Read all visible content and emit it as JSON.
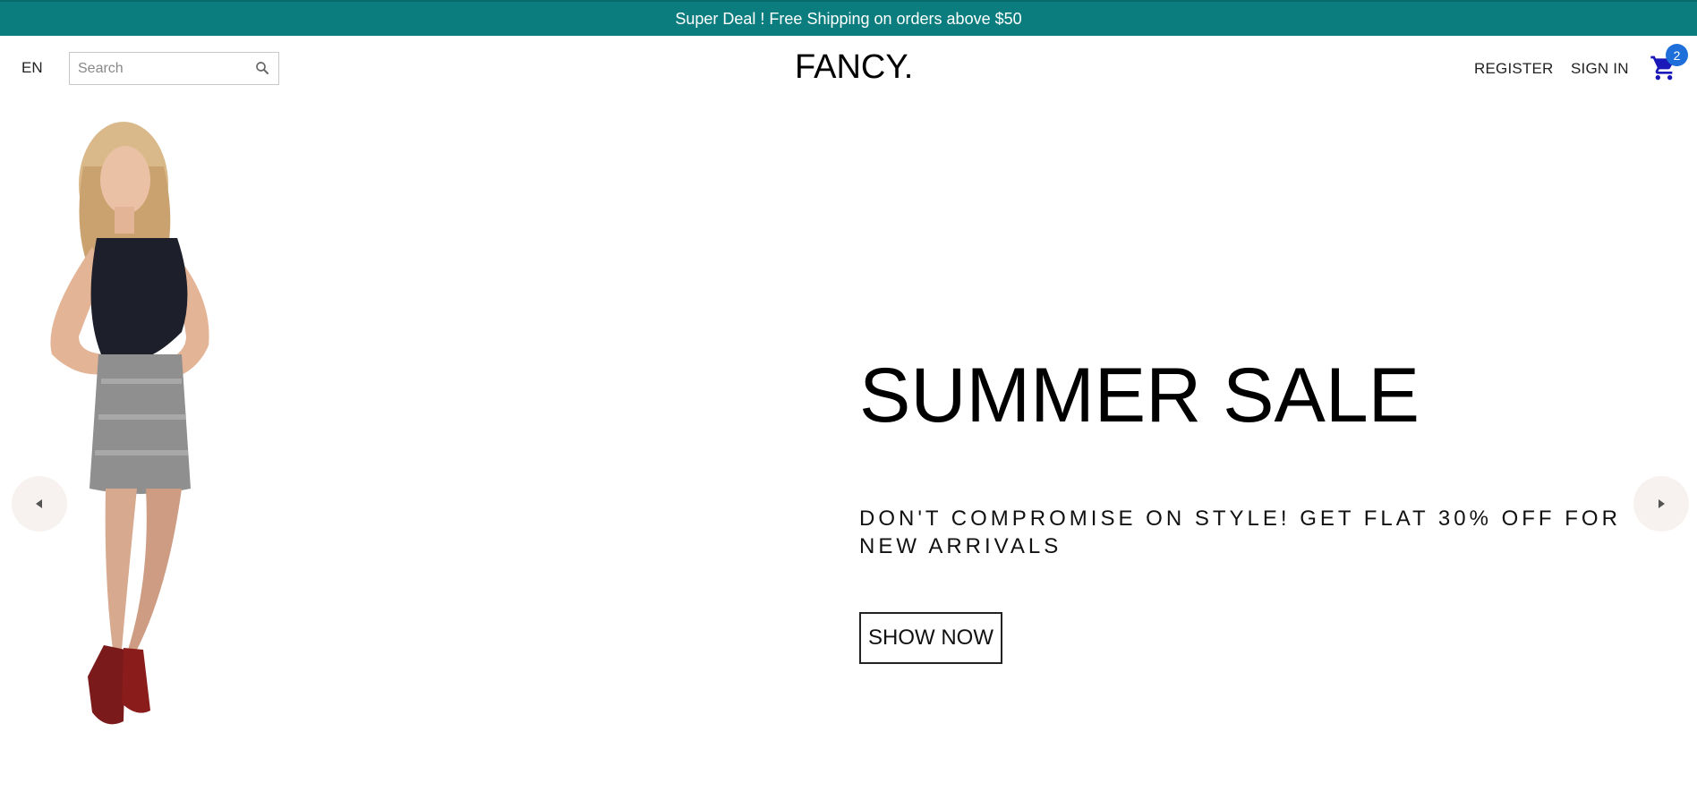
{
  "announcement": {
    "text": "Super Deal ! Free Shipping on orders above $50",
    "background_color": "#0b7d7f"
  },
  "navbar": {
    "language": "EN",
    "search": {
      "placeholder": "Search",
      "value": "",
      "icon": "search-icon"
    },
    "logo": "FANCY.",
    "links": {
      "register": "REGISTER",
      "sign_in": "SIGN IN"
    },
    "cart": {
      "icon": "shopping-cart-icon",
      "badge_count": "2",
      "badge_color": "#1e6fd9"
    }
  },
  "slider": {
    "title": "SUMMER SALE",
    "description": "DON'T COMPROMISE ON STYLE! GET FLAT 30% OFF FOR NEW ARRIVALS",
    "button_label": "SHOW NOW",
    "prev_icon": "arrow-left-icon",
    "next_icon": "arrow-right-icon"
  }
}
